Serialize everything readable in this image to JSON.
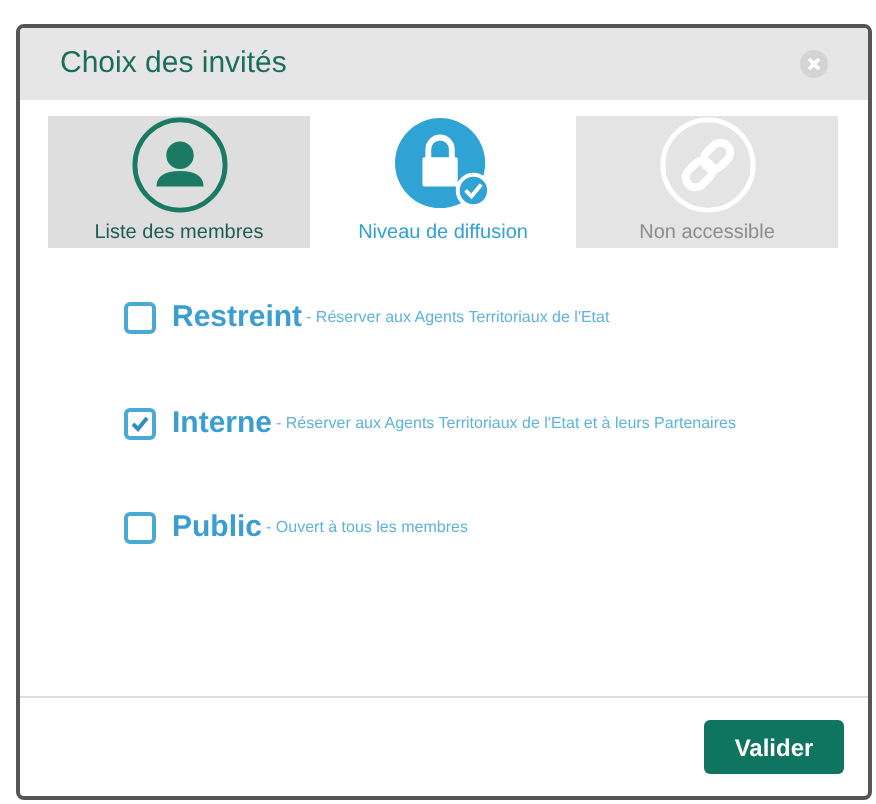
{
  "dialog": {
    "title": "Choix des invités"
  },
  "tabs": [
    {
      "label": "Liste des membres",
      "kind": "members",
      "selected": false,
      "disabled": false
    },
    {
      "label": "Niveau de diffusion",
      "kind": "lock",
      "selected": true,
      "disabled": false
    },
    {
      "label": "Non accessible",
      "kind": "link",
      "selected": false,
      "disabled": true
    }
  ],
  "options": [
    {
      "title": "Restreint",
      "description": "- Réserver aux Agents Territoriaux de l'Etat",
      "checked": false
    },
    {
      "title": "Interne",
      "description": "- Réserver aux Agents Territoriaux de l'Etat et à leurs Partenaires",
      "checked": true
    },
    {
      "title": "Public",
      "description": "- Ouvert à tous les membres",
      "checked": false
    }
  ],
  "buttons": [
    "Valider"
  ]
}
